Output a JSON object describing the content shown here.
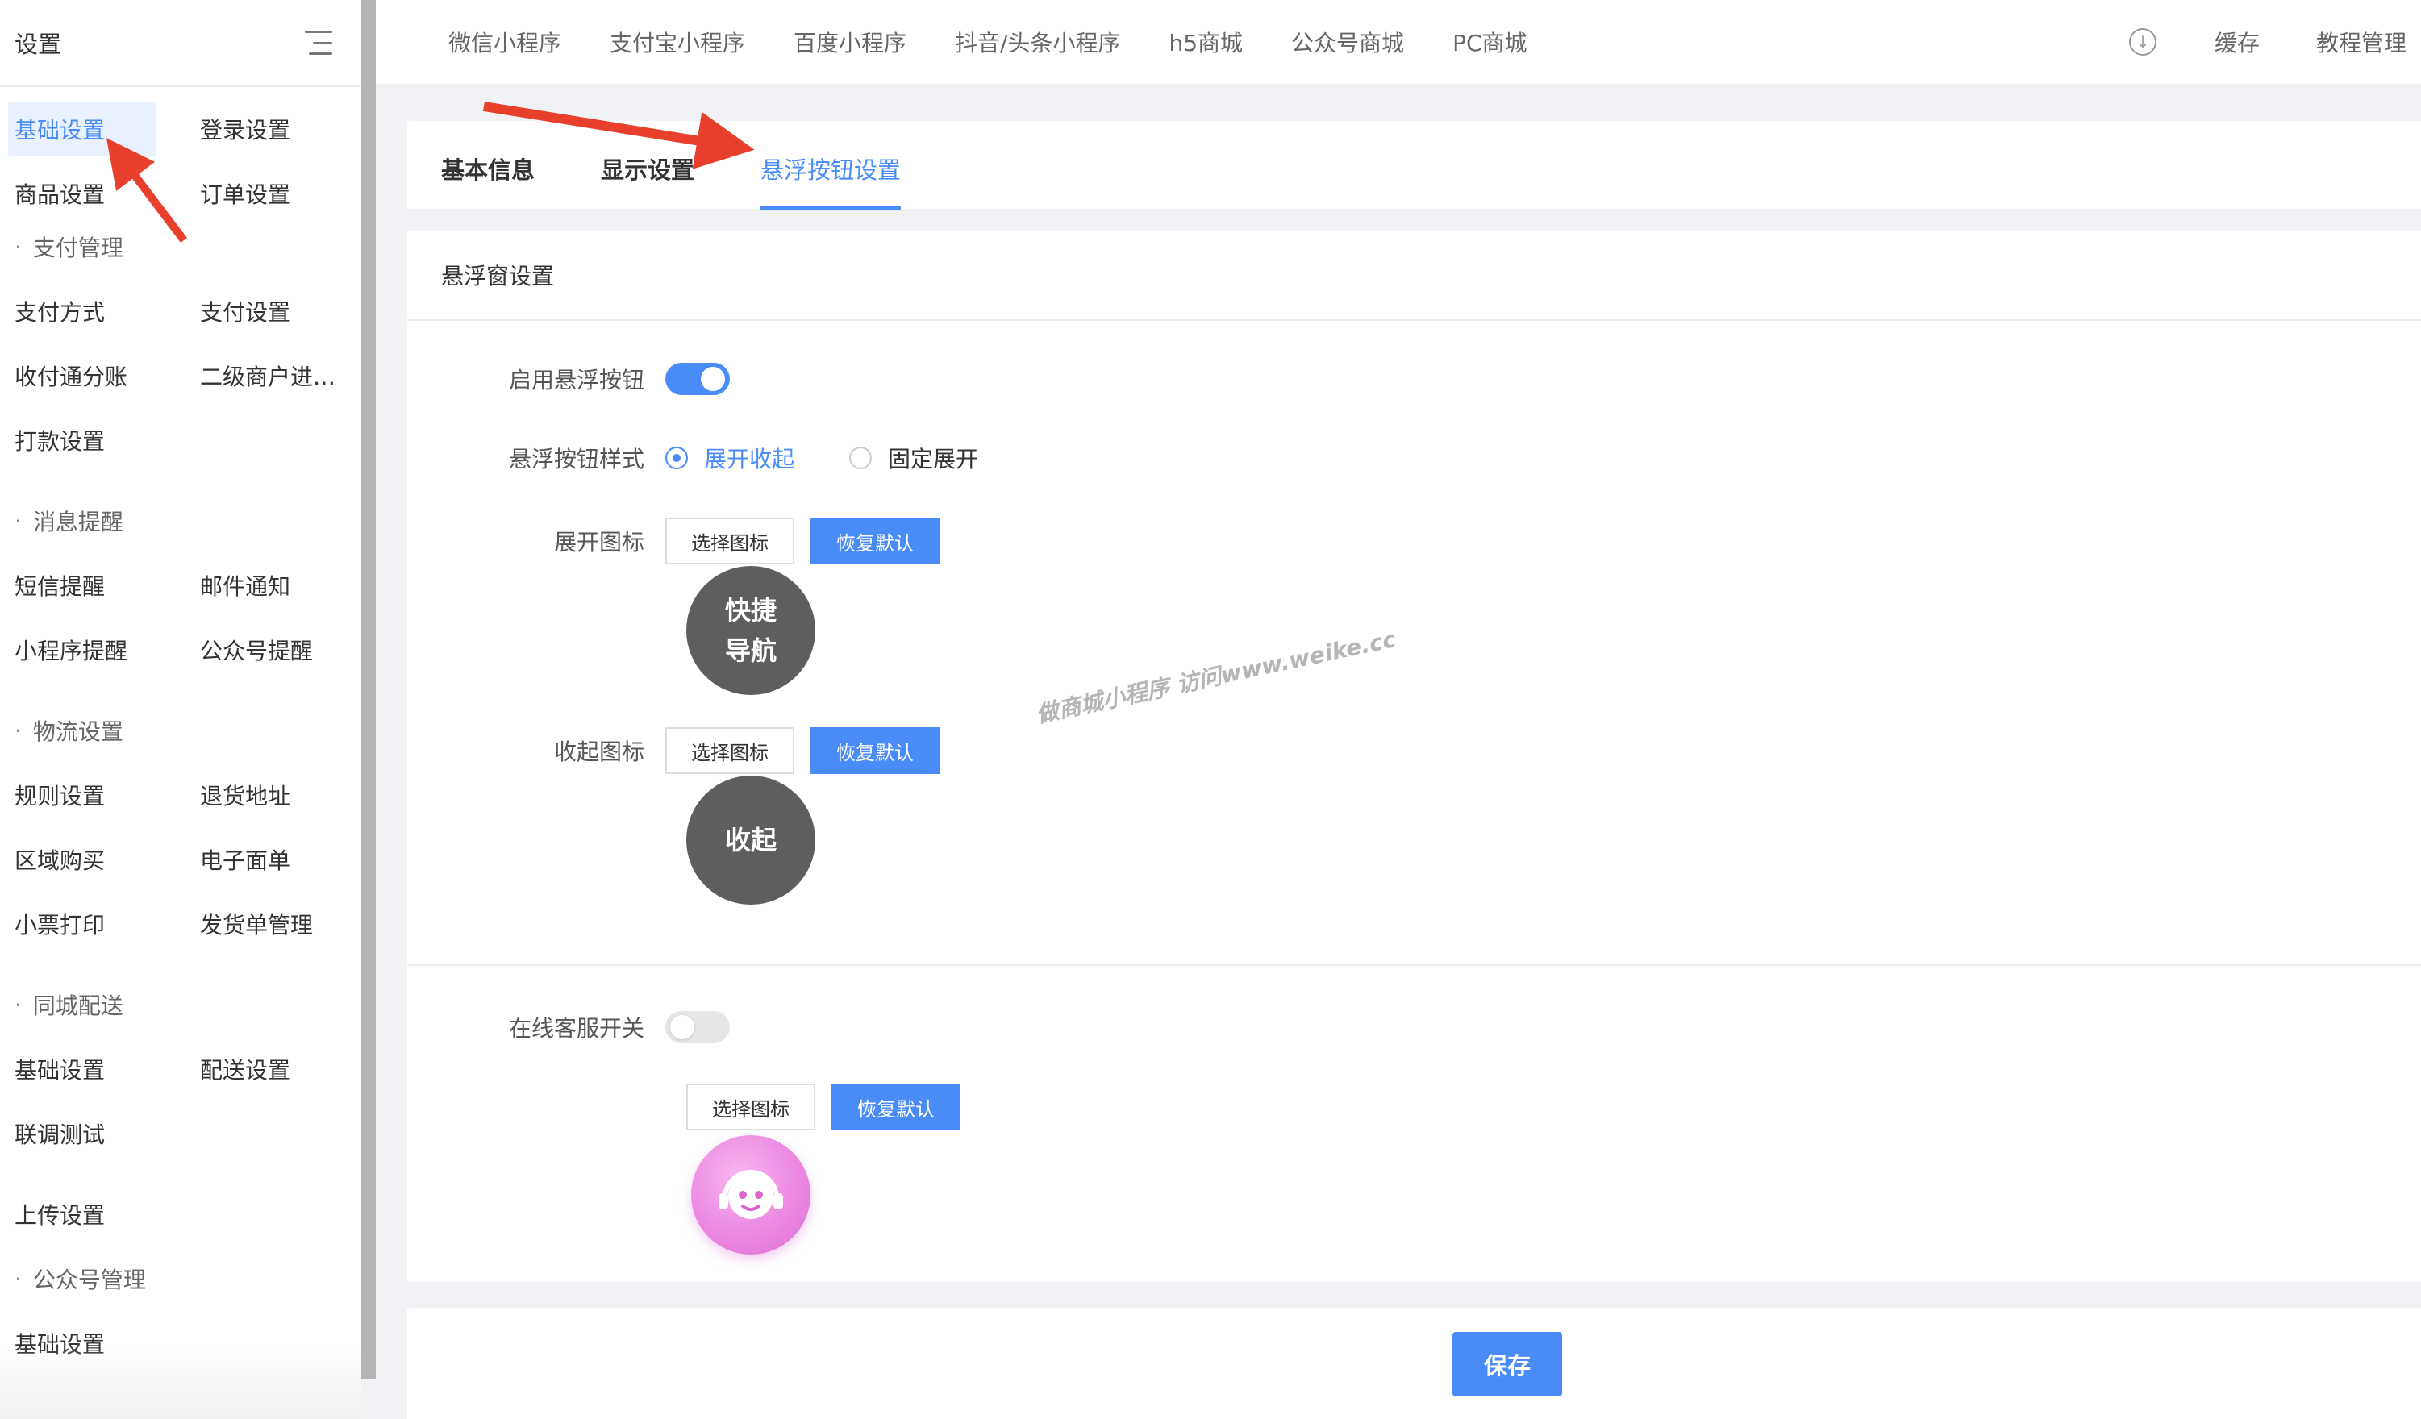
{
  "sidebar": {
    "title": "设置",
    "groups": [
      {
        "items": [
          "基础设置",
          "登录设置",
          "商品设置",
          "订单设置"
        ]
      },
      {
        "section": "支付管理",
        "items": [
          "支付方式",
          "支付设置",
          "收付通分账",
          "二级商户进…",
          "打款设置"
        ]
      },
      {
        "section": "消息提醒",
        "items": [
          "短信提醒",
          "邮件通知",
          "小程序提醒",
          "公众号提醒"
        ]
      },
      {
        "section": "物流设置",
        "items": [
          "规则设置",
          "退货地址",
          "区域购买",
          "电子面单",
          "小票打印",
          "发货单管理"
        ]
      },
      {
        "section": "同城配送",
        "items": [
          "基础设置",
          "配送设置",
          "联调测试"
        ]
      },
      {
        "items": [
          "上传设置"
        ]
      },
      {
        "section": "公众号管理",
        "items": [
          "基础设置"
        ]
      }
    ]
  },
  "topnav": {
    "items": [
      "微信小程序",
      "支付宝小程序",
      "百度小程序",
      "抖音/头条小程序",
      "h5商城",
      "公众号商城",
      "PC商城"
    ],
    "cache": "缓存",
    "tutorial": "教程管理"
  },
  "tabs": [
    "基本信息",
    "显示设置",
    "悬浮按钮设置"
  ],
  "card": {
    "title": "悬浮窗设置",
    "enable_label": "启用悬浮按钮",
    "style_label": "悬浮按钮样式",
    "style_options": [
      "展开收起",
      "固定展开"
    ],
    "expand_icon_label": "展开图标",
    "collapse_icon_label": "收起图标",
    "select_icon": "选择图标",
    "restore_default": "恢复默认",
    "expand_icon_line1": "快捷",
    "expand_icon_line2": "导航",
    "collapse_icon_text": "收起",
    "cs_label": "在线客服开关"
  },
  "footer": {
    "save": "保存"
  },
  "watermark": "做商城小程序 访问www.weike.cc",
  "colors": {
    "accent": "#4a8cf7",
    "annotation_arrow": "#e8402c"
  }
}
